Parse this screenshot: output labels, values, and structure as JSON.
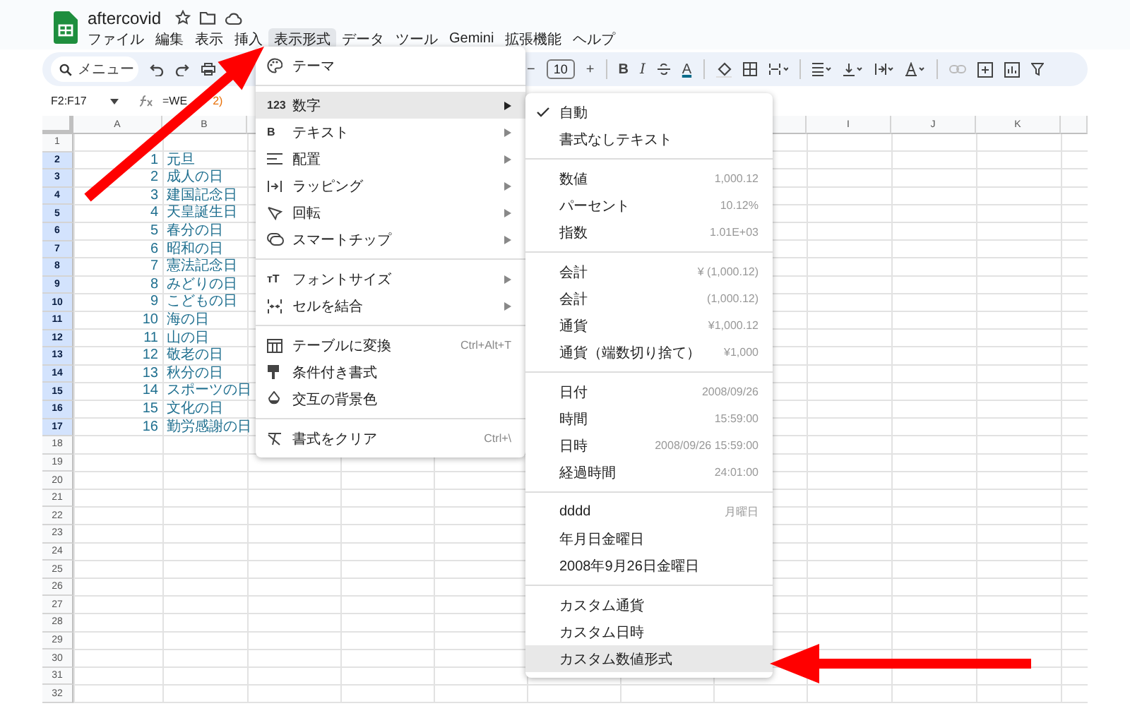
{
  "app": {
    "title": "aftercovid",
    "menus": [
      {
        "label": "ファイル",
        "selected": false
      },
      {
        "label": "編集",
        "selected": false
      },
      {
        "label": "表示",
        "selected": false
      },
      {
        "label": "挿入",
        "selected": false
      },
      {
        "label": "表示形式",
        "selected": true
      },
      {
        "label": "データ",
        "selected": false
      },
      {
        "label": "ツール",
        "selected": false
      },
      {
        "label": "Gemini",
        "selected": false
      },
      {
        "label": "拡張機能",
        "selected": false
      },
      {
        "label": "ヘルプ",
        "selected": false
      }
    ]
  },
  "toolbar": {
    "search_placeholder": "メニュー",
    "decrease": "−",
    "font_size": "10",
    "increase": "+",
    "bold": "B",
    "italic": "I",
    "text_color": "A"
  },
  "formula_bar": {
    "range": "F2:F17",
    "formula_start": "=WE",
    "formula_end": "2)"
  },
  "columns": [
    "A",
    "B",
    "I",
    "J",
    "K"
  ],
  "rows": [
    {
      "n": "1",
      "selected": false
    },
    {
      "n": "2",
      "selected": true,
      "a": "1",
      "b": "元旦"
    },
    {
      "n": "3",
      "selected": true,
      "a": "2",
      "b": "成人の日"
    },
    {
      "n": "4",
      "selected": true,
      "a": "3",
      "b": "建国記念日"
    },
    {
      "n": "5",
      "selected": true,
      "a": "4",
      "b": "天皇誕生日"
    },
    {
      "n": "6",
      "selected": true,
      "a": "5",
      "b": "春分の日"
    },
    {
      "n": "7",
      "selected": true,
      "a": "6",
      "b": "昭和の日"
    },
    {
      "n": "8",
      "selected": true,
      "a": "7",
      "b": "憲法記念日"
    },
    {
      "n": "9",
      "selected": true,
      "a": "8",
      "b": "みどりの日"
    },
    {
      "n": "10",
      "selected": true,
      "a": "9",
      "b": "こどもの日"
    },
    {
      "n": "11",
      "selected": true,
      "a": "10",
      "b": "海の日"
    },
    {
      "n": "12",
      "selected": true,
      "a": "11",
      "b": "山の日"
    },
    {
      "n": "13",
      "selected": true,
      "a": "12",
      "b": "敬老の日"
    },
    {
      "n": "14",
      "selected": true,
      "a": "13",
      "b": "秋分の日"
    },
    {
      "n": "15",
      "selected": true,
      "a": "14",
      "b": "スポーツの日"
    },
    {
      "n": "16",
      "selected": true,
      "a": "15",
      "b": "文化の日"
    },
    {
      "n": "17",
      "selected": true,
      "a": "16",
      "b": "勤労感謝の日"
    },
    {
      "n": "18",
      "selected": false
    },
    {
      "n": "19",
      "selected": false
    },
    {
      "n": "20",
      "selected": false
    },
    {
      "n": "21",
      "selected": false
    },
    {
      "n": "22",
      "selected": false
    },
    {
      "n": "23",
      "selected": false
    },
    {
      "n": "24",
      "selected": false
    },
    {
      "n": "25",
      "selected": false
    },
    {
      "n": "26",
      "selected": false
    },
    {
      "n": "27",
      "selected": false
    },
    {
      "n": "28",
      "selected": false
    },
    {
      "n": "29",
      "selected": false
    },
    {
      "n": "30",
      "selected": false
    },
    {
      "n": "31",
      "selected": false
    },
    {
      "n": "32",
      "selected": false
    }
  ],
  "format_menu": {
    "items": [
      {
        "kind": "item",
        "label": "テーマ",
        "submenu": false,
        "selected": false
      },
      {
        "kind": "separator"
      },
      {
        "kind": "item",
        "icon_text": "123",
        "label": "数字",
        "submenu": true,
        "selected": true
      },
      {
        "kind": "item",
        "icon_text": "B",
        "label": "テキスト",
        "submenu": true,
        "selected": false
      },
      {
        "kind": "item",
        "label": "配置",
        "submenu": true,
        "selected": false
      },
      {
        "kind": "item",
        "label": "ラッピング",
        "submenu": true,
        "selected": false
      },
      {
        "kind": "item",
        "label": "回転",
        "submenu": true,
        "selected": false
      },
      {
        "kind": "item",
        "label": "スマートチップ",
        "submenu": true,
        "selected": false
      },
      {
        "kind": "separator"
      },
      {
        "kind": "item",
        "icon_text": "ᴛT",
        "label": "フォントサイズ",
        "submenu": true,
        "selected": false
      },
      {
        "kind": "item",
        "label": "セルを結合",
        "submenu": true,
        "selected": false
      },
      {
        "kind": "separator"
      },
      {
        "kind": "item",
        "label": "テーブルに変換",
        "shortcut": "Ctrl+Alt+T",
        "submenu": false,
        "selected": false
      },
      {
        "kind": "item",
        "label": "条件付き書式",
        "submenu": false,
        "selected": false
      },
      {
        "kind": "item",
        "label": "交互の背景色",
        "submenu": false,
        "selected": false
      },
      {
        "kind": "separator"
      },
      {
        "kind": "item",
        "label": "書式をクリア",
        "shortcut": "Ctrl+\\",
        "submenu": false,
        "selected": false
      }
    ]
  },
  "number_submenu": {
    "items": [
      {
        "kind": "item",
        "label": "自動",
        "checked": true,
        "selected": false
      },
      {
        "kind": "item",
        "label": "書式なしテキスト",
        "checked": false,
        "selected": false
      },
      {
        "kind": "separator"
      },
      {
        "kind": "item",
        "label": "数値",
        "example": "1,000.12",
        "checked": false,
        "selected": false
      },
      {
        "kind": "item",
        "label": "パーセント",
        "example": "10.12%",
        "checked": false,
        "selected": false
      },
      {
        "kind": "item",
        "label": "指数",
        "example": "1.01E+03",
        "checked": false,
        "selected": false
      },
      {
        "kind": "separator"
      },
      {
        "kind": "item",
        "label": "会計",
        "example": "¥ (1,000.12)",
        "checked": false,
        "selected": false
      },
      {
        "kind": "item",
        "label": "会計",
        "example": "(1,000.12)",
        "checked": false,
        "selected": false
      },
      {
        "kind": "item",
        "label": "通貨",
        "example": "¥1,000.12",
        "checked": false,
        "selected": false
      },
      {
        "kind": "item",
        "label": "通貨（端数切り捨て）",
        "example": "¥1,000",
        "checked": false,
        "selected": false
      },
      {
        "kind": "separator"
      },
      {
        "kind": "item",
        "label": "日付",
        "example": "2008/09/26",
        "checked": false,
        "selected": false
      },
      {
        "kind": "item",
        "label": "時間",
        "example": "15:59:00",
        "checked": false,
        "selected": false
      },
      {
        "kind": "item",
        "label": "日時",
        "example": "2008/09/26 15:59:00",
        "checked": false,
        "selected": false
      },
      {
        "kind": "item",
        "label": "経過時間",
        "example": "24:01:00",
        "checked": false,
        "selected": false
      },
      {
        "kind": "separator"
      },
      {
        "kind": "item",
        "label": "dddd",
        "example": "月曜日",
        "checked": false,
        "selected": false
      },
      {
        "kind": "item",
        "label": "年月日金曜日",
        "checked": false,
        "selected": false
      },
      {
        "kind": "item",
        "label": "2008年9月26日金曜日",
        "checked": false,
        "selected": false
      },
      {
        "kind": "separator"
      },
      {
        "kind": "item",
        "label": "カスタム通貨",
        "checked": false,
        "selected": false
      },
      {
        "kind": "item",
        "label": "カスタム日時",
        "checked": false,
        "selected": false
      },
      {
        "kind": "item",
        "label": "カスタム数値形式",
        "checked": false,
        "selected": true
      }
    ]
  }
}
